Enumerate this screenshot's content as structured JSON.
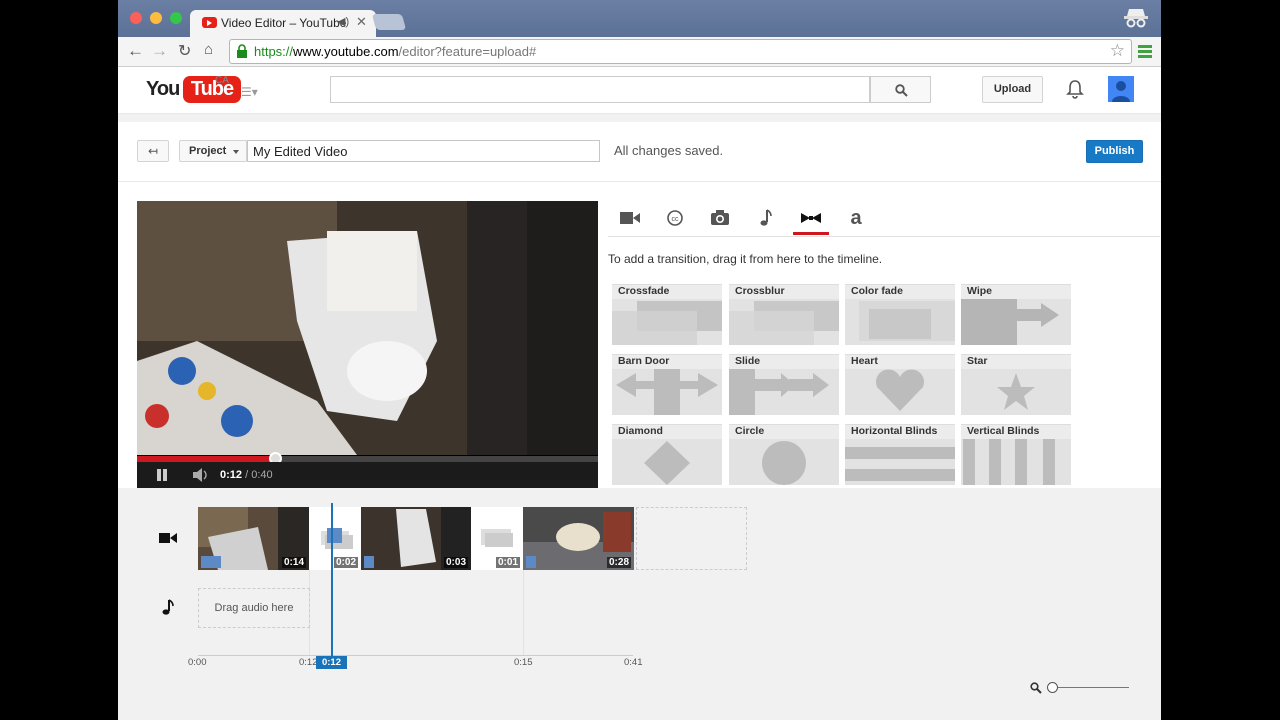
{
  "browser": {
    "tab_title": "Video Editor – YouTube",
    "tab_close": "✕",
    "url_scheme": "https://",
    "url_host": "www.youtube.com",
    "url_path": "/editor?feature=upload#",
    "colors": {
      "frame": "#5c7196",
      "secure": "#1a8c1a"
    }
  },
  "header": {
    "logo_you": "You",
    "logo_tube": "Tube",
    "logo_region": "CA",
    "upload_label": "Upload",
    "colors": {
      "brand": "#e62117"
    }
  },
  "editor": {
    "back_label": "↤",
    "project_label": "Project",
    "title_value": "My Edited Video",
    "save_status": "All changes saved.",
    "publish_label": "Publish",
    "colors": {
      "publish": "#167ac6"
    }
  },
  "player": {
    "time_current": "0:12",
    "time_total": " / 0:40",
    "progress": 0.3
  },
  "tools": {
    "tabs": [
      "video-camera-icon",
      "captions-icon",
      "photo-camera-icon",
      "music-note-icon",
      "transitions-bowtie-icon",
      "text-a-icon"
    ],
    "active_tab": "transitions",
    "text_tab_glyph": "a",
    "hint": "To add a transition, drag it from here to the timeline.",
    "transitions": [
      "Crossfade",
      "Crossblur",
      "Color fade",
      "Wipe",
      "Barn Door",
      "Slide",
      "Heart",
      "Star",
      "Diamond",
      "Circle",
      "Horizontal Blinds",
      "Vertical Blinds"
    ]
  },
  "timeline": {
    "clips": [
      {
        "kind": "video",
        "duration": "0:14"
      },
      {
        "kind": "transition",
        "duration": "0:02"
      },
      {
        "kind": "video",
        "duration": "0:03"
      },
      {
        "kind": "transition",
        "duration": "0:01"
      },
      {
        "kind": "video",
        "duration": "0:28"
      }
    ],
    "audio_placeholder": "Drag audio here",
    "ticks": [
      "0:00",
      "0:12",
      "0:15",
      "0:41"
    ],
    "playhead_label": "0:12",
    "colors": {
      "playhead": "#1a73b8"
    }
  }
}
